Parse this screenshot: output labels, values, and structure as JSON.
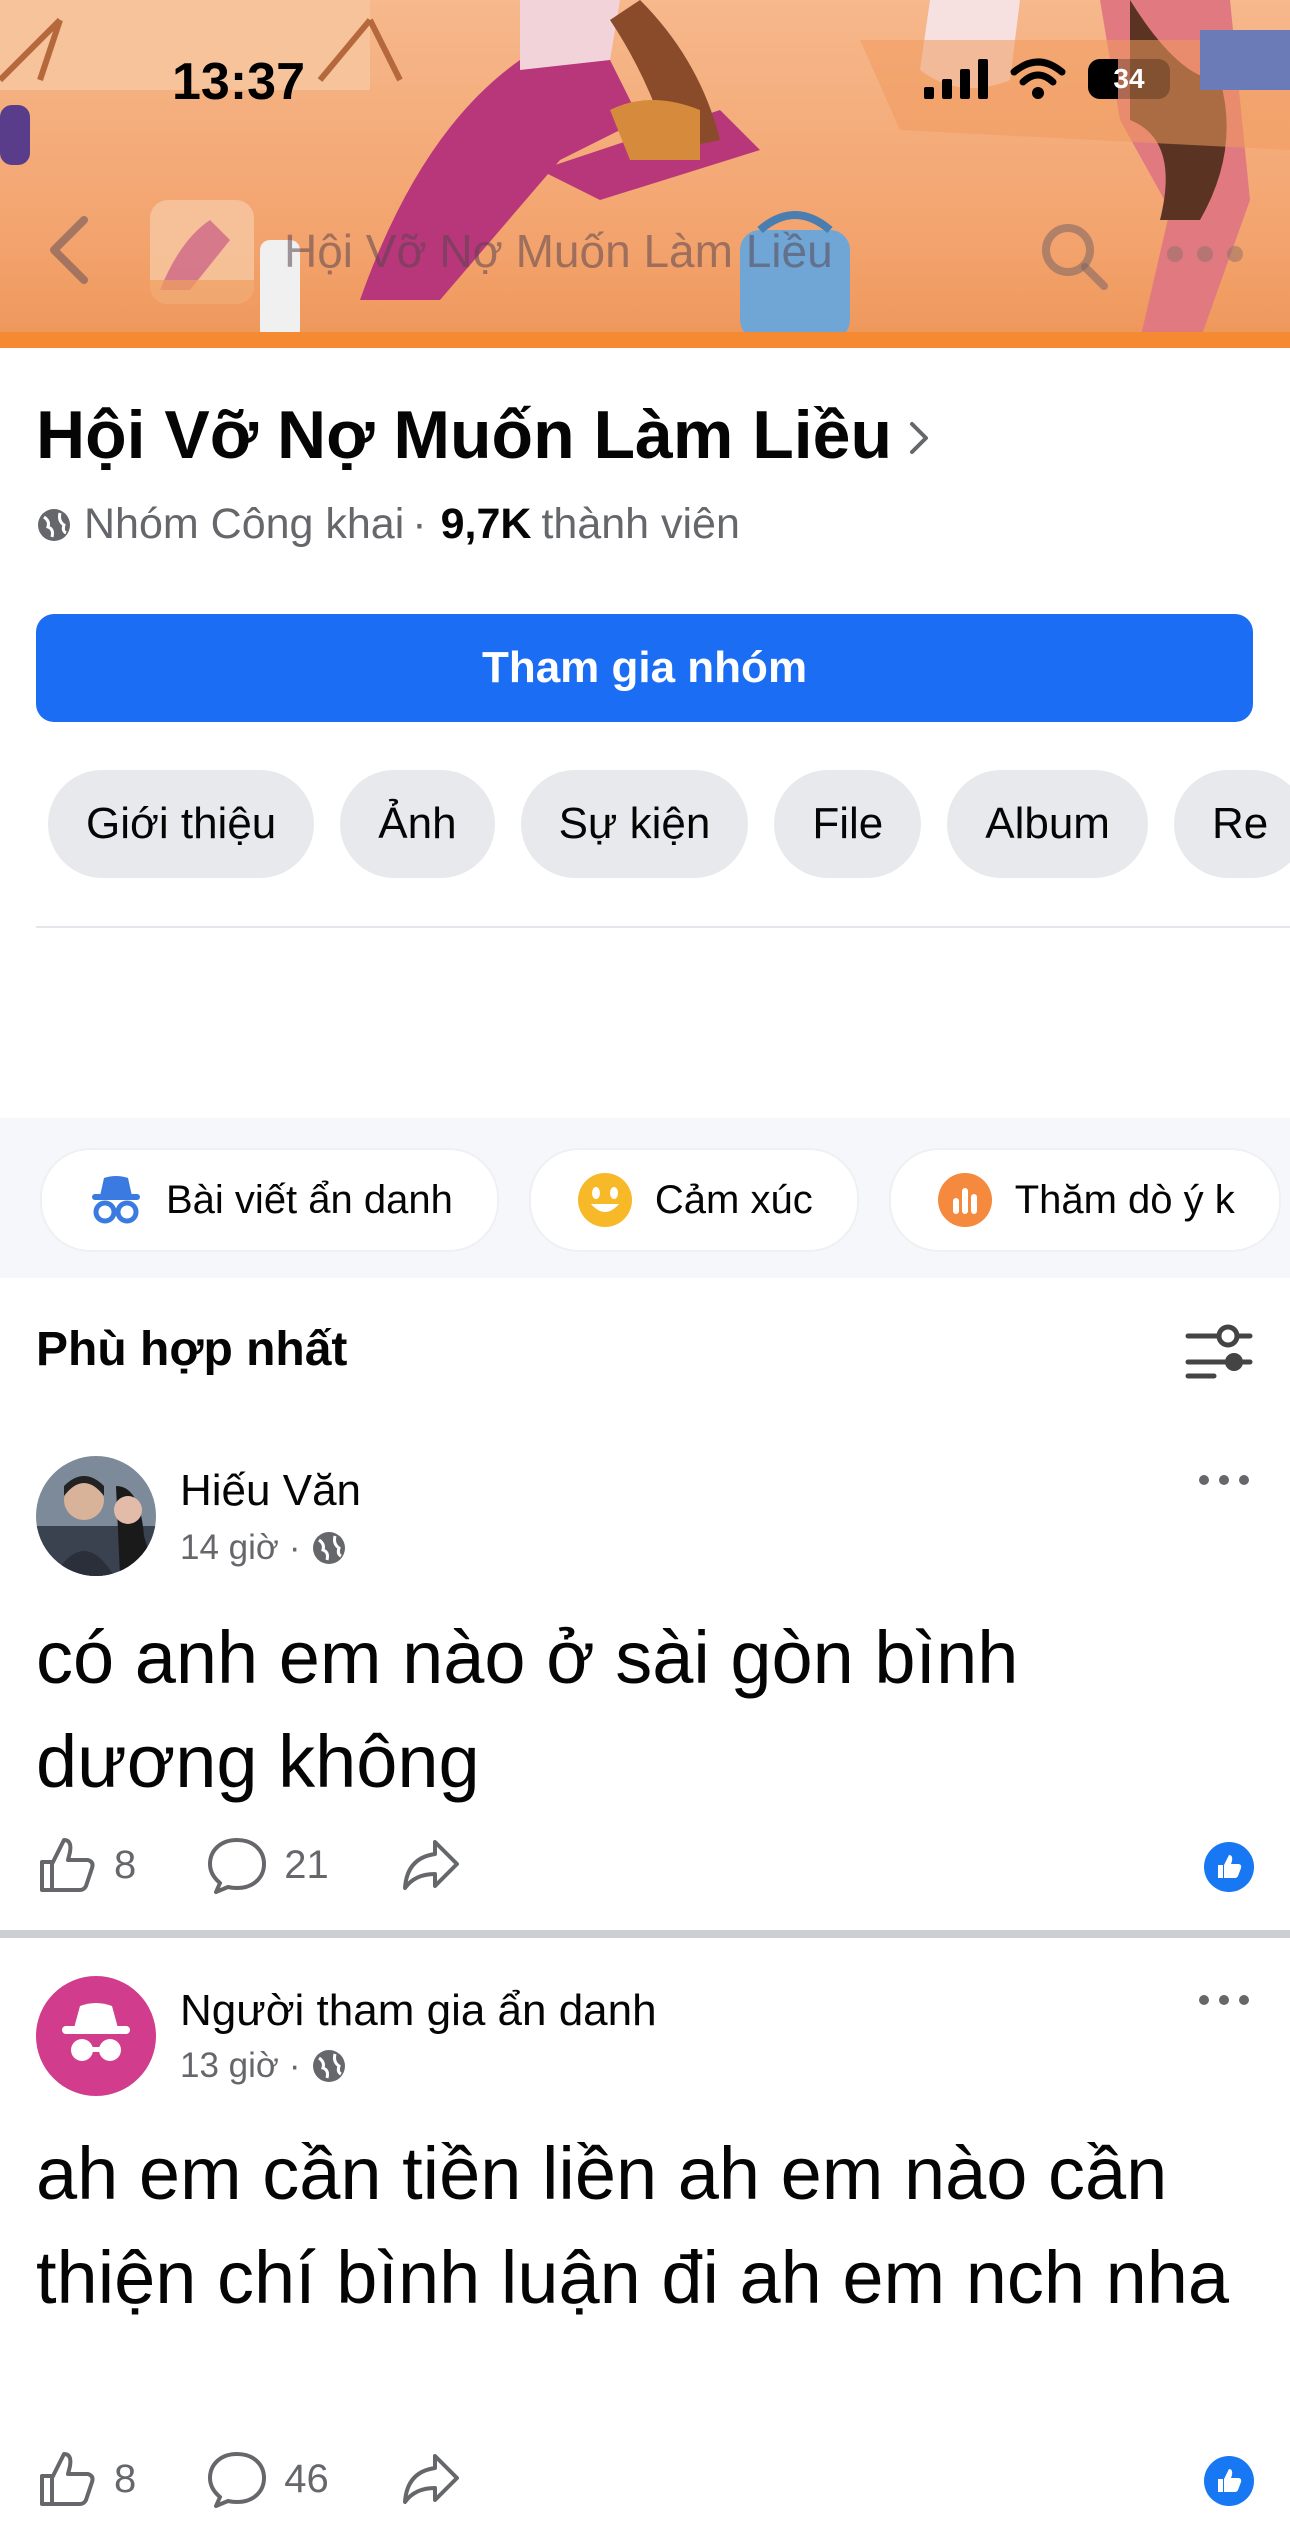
{
  "status_bar": {
    "time": "13:37",
    "battery": "34"
  },
  "nav": {
    "title": "Hội Vỡ Nợ Muốn Làm Liều"
  },
  "group": {
    "name": "Hội Vỡ Nợ Muốn Làm Liều",
    "privacy": "Nhóm Công khai",
    "separator": "·",
    "member_count": "9,7K",
    "member_label": "thành viên",
    "join_label": "Tham gia nhóm"
  },
  "tabs": [
    "Giới thiệu",
    "Ảnh",
    "Sự kiện",
    "File",
    "Album",
    "Re"
  ],
  "composer_chips": [
    {
      "label": "Bài viết ẩn danh",
      "icon": "anonymous-icon"
    },
    {
      "label": "Cảm xúc",
      "icon": "smile-emoji-icon"
    },
    {
      "label": "Thăm dò ý k",
      "icon": "poll-icon"
    }
  ],
  "feed": {
    "sort_label": "Phù hợp nhất",
    "posts": [
      {
        "author": "Hiếu Văn",
        "time": "14 giờ",
        "dot": "·",
        "text": "có anh em nào ở sài gòn bình dương không",
        "likes": "8",
        "comments": "21"
      },
      {
        "author": "Người tham gia ẩn danh",
        "time": "13 giờ",
        "dot": "·",
        "text": "ah em cần tiền liền ah em nào cần thiện chí bình luận đi ah em nch nha",
        "likes": "8",
        "comments": "46"
      }
    ]
  },
  "colors": {
    "brand_blue": "#1b6ef3",
    "cover_orange": "#f3a36d",
    "anon_pink": "#d23c8c",
    "text_secondary": "#65676b"
  }
}
